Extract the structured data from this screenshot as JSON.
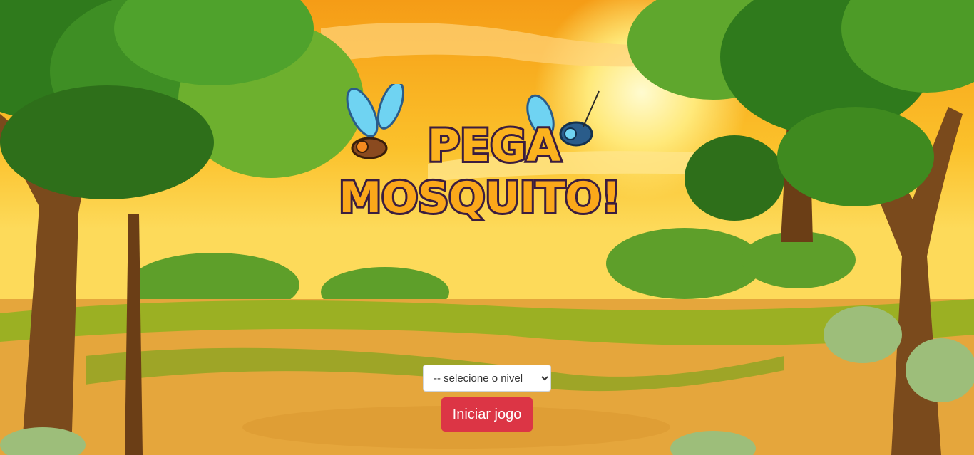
{
  "game": {
    "logo_line1": "PEGA",
    "logo_line2": "MOSQUITO!"
  },
  "controls": {
    "level_select": {
      "selected": "-- selecione o nivel",
      "options": [
        "-- selecione o nivel"
      ]
    },
    "start_button_label": "Iniciar jogo"
  },
  "colors": {
    "sky_top": "#F7A21B",
    "sky_glow": "#FFF3A0",
    "ground": "#E7A83D",
    "grass": "#8FAE1E",
    "tree_leaf": "#3F8A1F",
    "trunk": "#7A4A1C",
    "button": "#DC3545"
  }
}
